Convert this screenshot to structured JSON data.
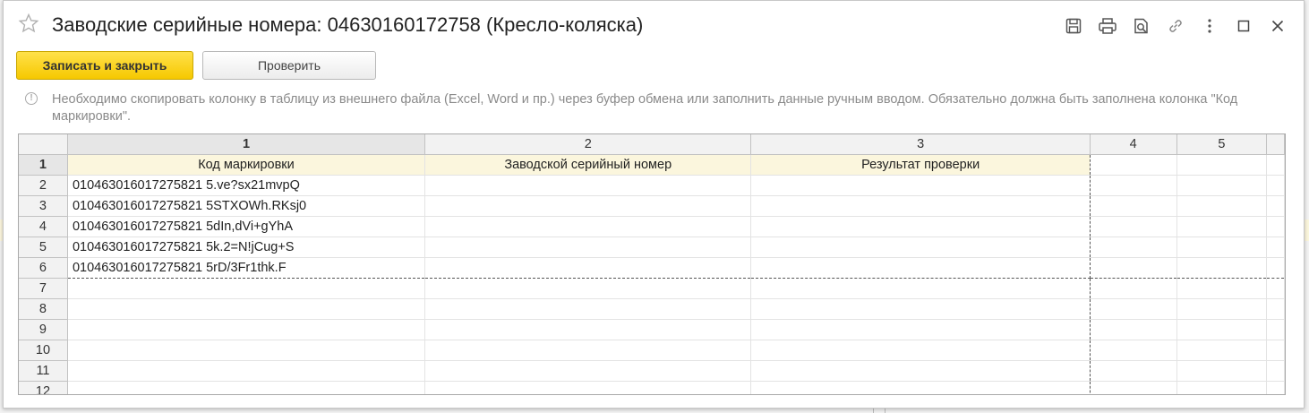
{
  "window": {
    "title": "Заводские серийные номера: 04630160172758 (Кресло-коляска)"
  },
  "titlebar_icons": [
    "save-icon",
    "print-icon",
    "preview-icon",
    "link-icon",
    "more-icon",
    "maximize-icon",
    "close-icon"
  ],
  "toolbar": {
    "save_close_label": "Записать и закрыть",
    "check_label": "Проверить"
  },
  "hint": {
    "text": "Необходимо скопировать колонку в таблицу из внешнего файла (Excel, Word и пр.) через буфер обмена или заполнить данные ручным вводом. Обязательно должна быть заполнена колонка \"Код маркировки\"."
  },
  "sheet": {
    "column_numbers": [
      "1",
      "2",
      "3",
      "4",
      "5"
    ],
    "header_row_number": "1",
    "headers": [
      "Код маркировки",
      "Заводской серийный номер",
      "Результат проверки"
    ],
    "rows": [
      {
        "num": "2",
        "code": "010463016017275821 5.ve?sx21mvpQ"
      },
      {
        "num": "3",
        "code": "010463016017275821 5STXOWh.RKsj0"
      },
      {
        "num": "4",
        "code": "010463016017275821 5dIn,dVi+gYhA"
      },
      {
        "num": "5",
        "code": "010463016017275821 5k.2=N!jCug+S"
      },
      {
        "num": "6",
        "code": "010463016017275821 5rD/3Fr1thk.F"
      }
    ],
    "empty_rows": [
      "7",
      "8",
      "9",
      "10",
      "11",
      "12"
    ]
  },
  "colors": {
    "primary_button": "#f6c800",
    "header_highlight": "#fbf6dd"
  }
}
